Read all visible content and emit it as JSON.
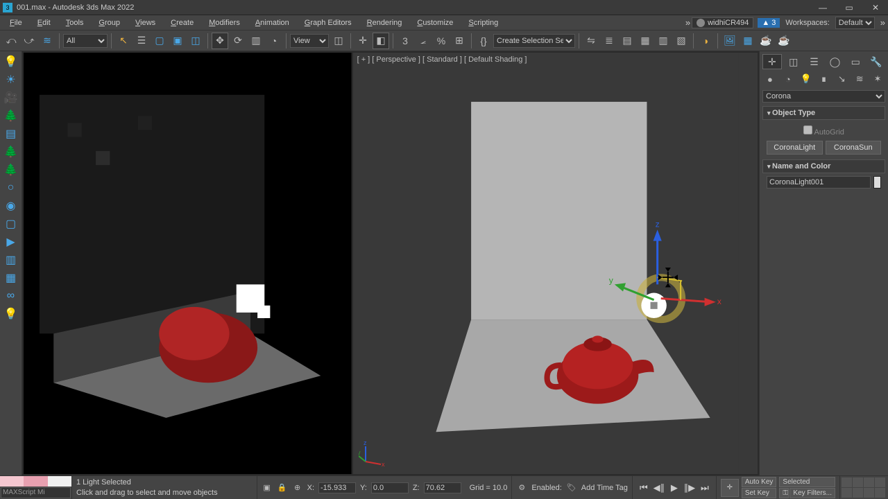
{
  "title": "001.max - Autodesk 3ds Max 2022",
  "menus": [
    "File",
    "Edit",
    "Tools",
    "Group",
    "Views",
    "Create",
    "Modifiers",
    "Animation",
    "Graph Editors",
    "Rendering",
    "Customize",
    "Scripting"
  ],
  "user": "widhiCR494",
  "notif_count": "3",
  "workspace_label": "Workspaces:",
  "workspace_value": "Default",
  "toolbar": {
    "filter_sel": "All",
    "view_sel": "View",
    "selset": "Create Selection Se"
  },
  "viewport": {
    "label": "[ + ] [ Perspective ] [ Standard ] [ Default Shading ]",
    "axis": {
      "x": "x",
      "y": "y",
      "z": "z"
    }
  },
  "right_panel": {
    "renderer": "Corona",
    "rollout_type": "Object Type",
    "autogrid": "AutoGrid",
    "btn_light": "CoronaLight",
    "btn_sun": "CoronaSun",
    "rollout_name": "Name and Color",
    "obj_name": "CoronaLight001"
  },
  "status": {
    "sel": "1 Light Selected",
    "hint": "Click and drag to select and move objects",
    "mxs": "MAXScript Mi",
    "enabled": "Enabled:",
    "coord_x": "-15.933",
    "coord_y": "0.0",
    "coord_z": "70.62",
    "grid": "Grid = 10.0",
    "timetag": "Add Time Tag",
    "autokey": "Auto Key",
    "selected": "Selected",
    "setkey": "Set Key",
    "keyfilters": "Key Filters..."
  }
}
